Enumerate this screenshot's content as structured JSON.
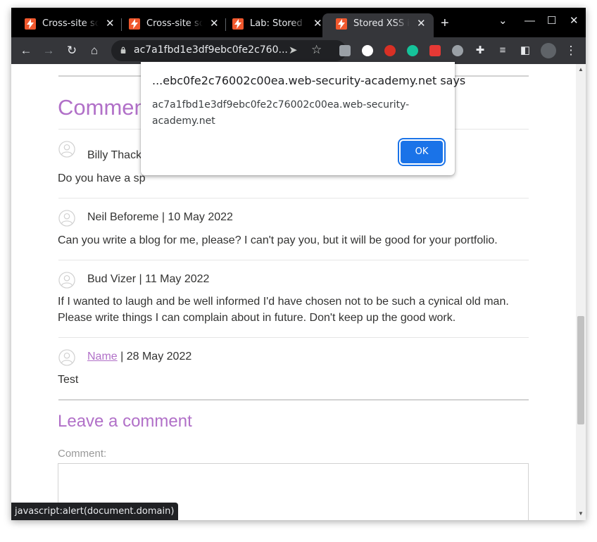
{
  "browser": {
    "tabs": [
      {
        "title": "Cross-site scripting"
      },
      {
        "title": "Cross-site scripting"
      },
      {
        "title": "Lab: Stored XSS"
      },
      {
        "title": "Stored XSS into"
      }
    ],
    "url": "ac7a1fbd1e3df9ebc0fe2c760..."
  },
  "page": {
    "comments_heading": "Comments",
    "comments": [
      {
        "author": "Billy Thackid",
        "date": "",
        "meta_visible": "Billy Thack",
        "text": "Do you have a sp"
      },
      {
        "meta": "Neil Beforeme | 10 May 2022",
        "text": "Can you write a blog for me, please? I can't pay you, but it will be good for your portfolio."
      },
      {
        "meta": "Bud Vizer | 11 May 2022",
        "text": "If I wanted to laugh and be well informed I'd have chosen not to be such a cynical old man. Please write things I can complain about in future. Don't keep up the good work."
      },
      {
        "author_link": "Name",
        "date_suffix": " | 28 May 2022",
        "text": "Test"
      }
    ],
    "leave_heading": "Leave a comment",
    "comment_label": "Comment:"
  },
  "status_bar": "javascript:alert(document.domain)",
  "dialog": {
    "title": "...ebc0fe2c76002c00ea.web-security-academy.net says",
    "message": "ac7a1fbd1e3df9ebc0fe2c76002c00ea.web-security-academy.net",
    "ok_label": "OK"
  },
  "colors": {
    "accent": "#b170c8",
    "favicon": "#f0582d",
    "ok_button": "#1a73e8"
  }
}
